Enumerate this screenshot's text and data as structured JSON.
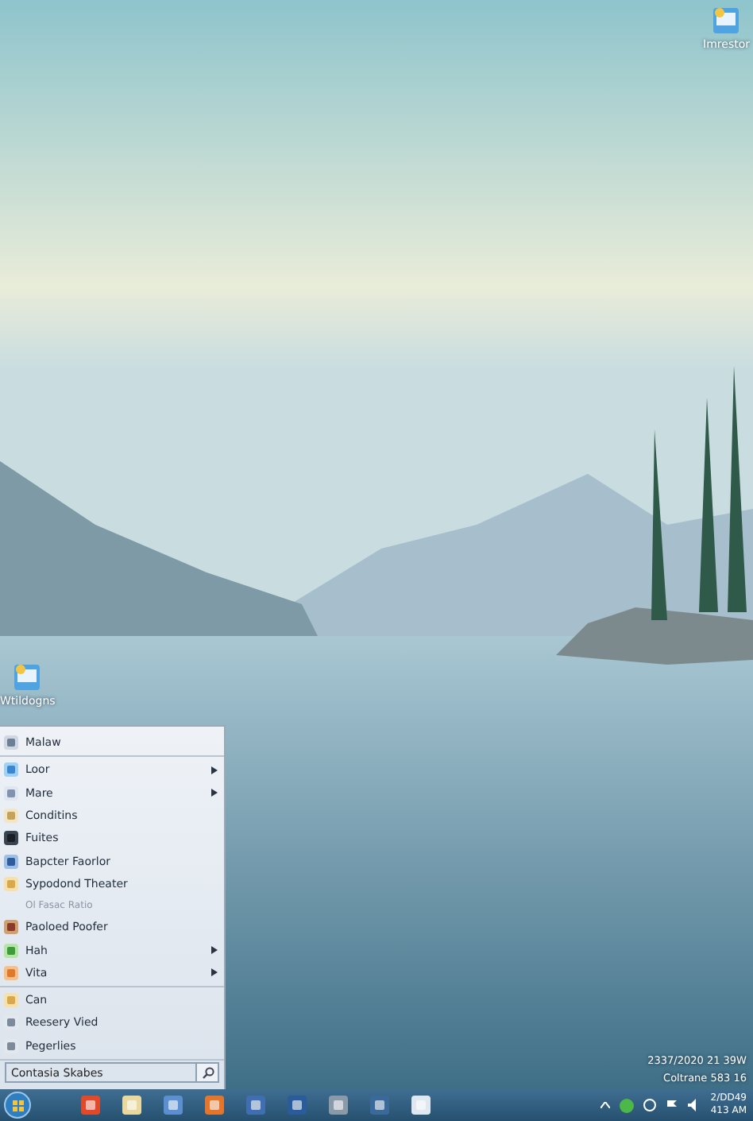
{
  "desktop_icons": [
    {
      "label": "Imrestor"
    },
    {
      "label": "Wtildogns"
    }
  ],
  "corner_text": [
    "2337/2020 21 39W",
    "Coltrane 583 16"
  ],
  "start_menu": {
    "groups": [
      [
        {
          "label": "Malaw",
          "kind": "item",
          "has_submenu": false
        }
      ],
      [
        {
          "label": "Loor",
          "kind": "item",
          "has_submenu": true
        },
        {
          "label": "Mare",
          "kind": "item",
          "has_submenu": true
        },
        {
          "label": "Conditins",
          "kind": "item",
          "has_submenu": false
        },
        {
          "label": "Fuites",
          "kind": "item",
          "has_submenu": false
        },
        {
          "label": "Bapcter Faorlor",
          "kind": "item",
          "has_submenu": false
        },
        {
          "label": "Sypodond Theater",
          "kind": "item",
          "has_submenu": false
        },
        {
          "label": "Ol Fasac Ratio",
          "kind": "heading"
        },
        {
          "label": "Paoloed Poofer",
          "kind": "item",
          "has_submenu": false
        },
        {
          "label": "Hah",
          "kind": "item",
          "has_submenu": true
        },
        {
          "label": "Vita",
          "kind": "item",
          "has_submenu": true
        }
      ],
      [
        {
          "label": "Can",
          "kind": "item",
          "has_submenu": false
        },
        {
          "label": "Reesery Vied",
          "kind": "item",
          "has_submenu": false
        },
        {
          "label": "Pegerlies",
          "kind": "item",
          "has_submenu": false
        }
      ]
    ],
    "search": {
      "value": "Contasia Skabes"
    }
  },
  "taskbar": {
    "clock": [
      "2/DD49",
      "413 AM"
    ]
  }
}
